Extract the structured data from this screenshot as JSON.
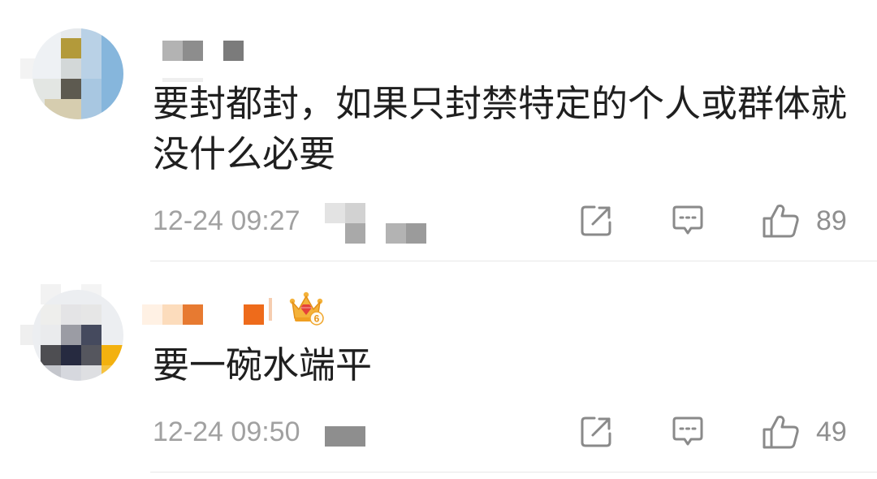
{
  "comments": [
    {
      "text": "要封都封，如果只封禁特定的个人或群体就没什么必要",
      "time": "12-24 09:27",
      "likes": 89
    },
    {
      "text": "要一碗水端平",
      "time": "12-24 09:50",
      "likes": 49,
      "badge": {
        "icon": "crown-badge-icon",
        "level": 6
      }
    }
  ],
  "actions": {
    "share_icon": "share-icon",
    "comment_icon": "comment-icon",
    "like_icon": "thumbs-up-icon"
  },
  "colors": {
    "text": "#1f1f1f",
    "meta": "#a1a1a1",
    "icon": "#8a8a8a",
    "count": "#8f8f8f",
    "divider": "#e8e8e8",
    "badge_gold": "#f4b23a",
    "badge_gem": "#e5413a"
  }
}
